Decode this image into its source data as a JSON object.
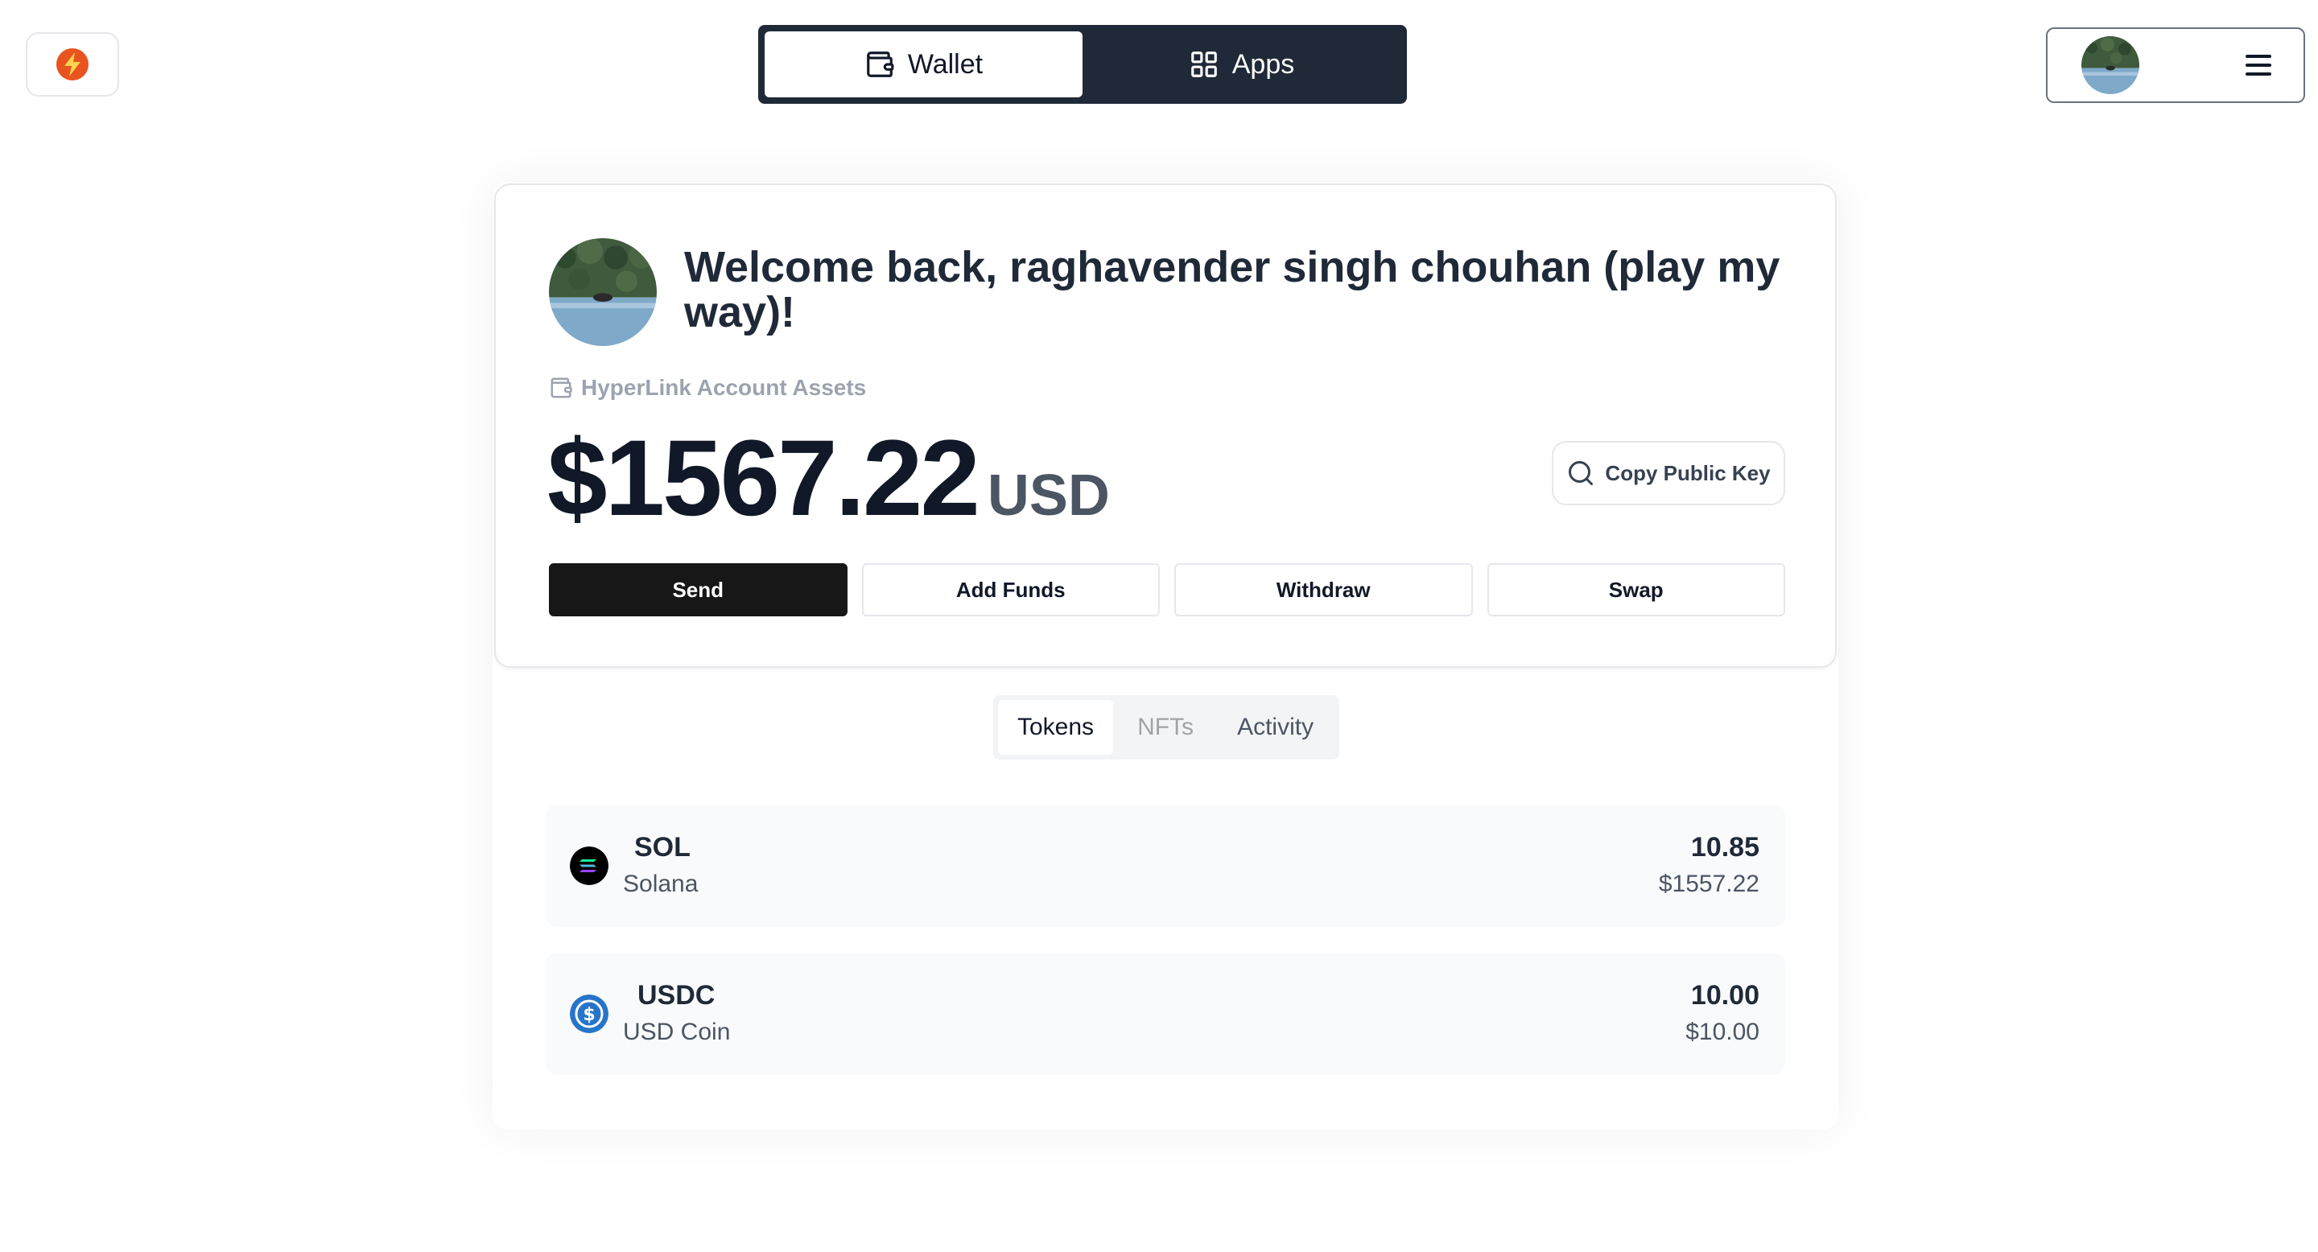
{
  "header": {
    "logo_icon": "lightning-icon",
    "nav": {
      "wallet_label": "Wallet",
      "apps_label": "Apps",
      "active": "wallet"
    },
    "menu_icon": "hamburger-menu-icon"
  },
  "summary": {
    "welcome": "Welcome back, raghavender singh chouhan (play my way)!",
    "assets_label": "HyperLink Account Assets",
    "balance_amount": "$1567.22",
    "balance_currency": "USD",
    "copy_key_label": "Copy Public Key",
    "actions": {
      "send": "Send",
      "add_funds": "Add Funds",
      "withdraw": "Withdraw",
      "swap": "Swap"
    }
  },
  "tabs": {
    "tokens": "Tokens",
    "nfts": "NFTs",
    "activity": "Activity",
    "active": "tokens"
  },
  "tokens": [
    {
      "symbol": "SOL",
      "name": "Solana",
      "amount": "10.85",
      "value": "$1557.22",
      "icon": "solana-icon",
      "color": "#000000"
    },
    {
      "symbol": "USDC",
      "name": "USD Coin",
      "amount": "10.00",
      "value": "$10.00",
      "icon": "usdc-icon",
      "color": "#2775ca"
    }
  ],
  "colors": {
    "nav_bg": "#1f2937",
    "primary_button": "#171717",
    "logo_orange": "#e8531f"
  }
}
